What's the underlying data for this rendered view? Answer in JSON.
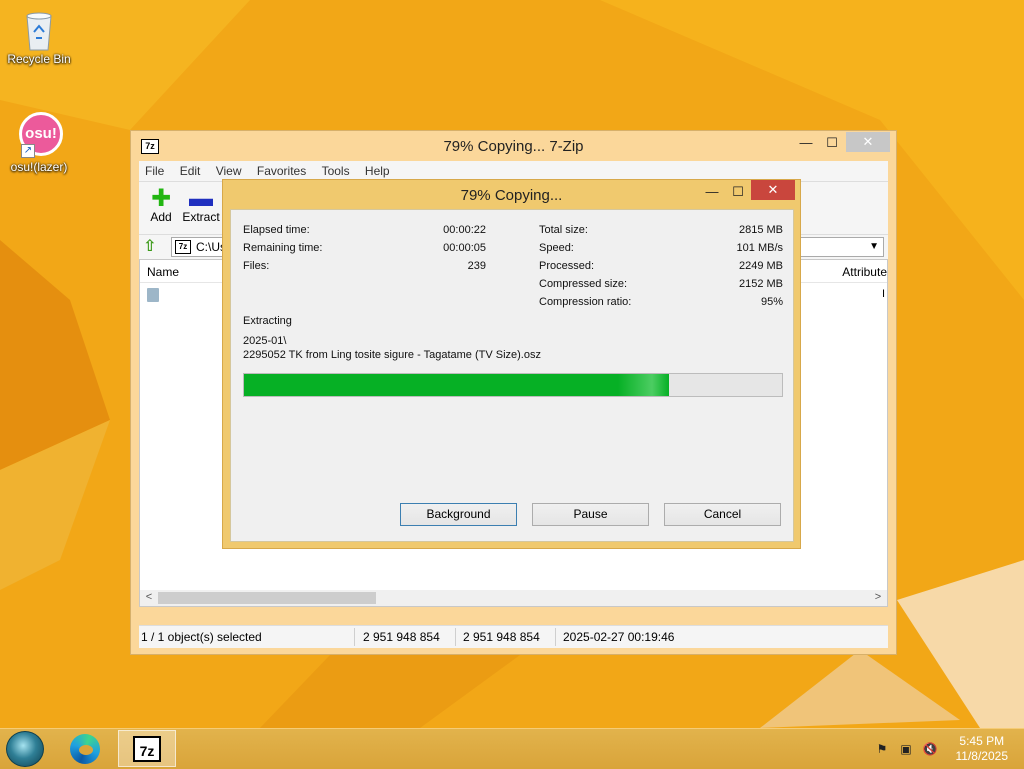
{
  "desktop": {
    "icons": [
      {
        "label": "Recycle Bin"
      },
      {
        "label": "osu!(lazer)",
        "logo_text": "osu!"
      }
    ]
  },
  "main_window": {
    "title": "79% Copying... 7-Zip",
    "app_icon_text": "7z",
    "menu": [
      "File",
      "Edit",
      "View",
      "Favorites",
      "Tools",
      "Help"
    ],
    "toolbar": {
      "add_label": "Add",
      "extract_label": "Extract"
    },
    "address": "C:\\Us",
    "columns": {
      "name": "Name",
      "attributes": "Attribute"
    },
    "status": {
      "selection": "1 / 1 object(s) selected",
      "size": "2 951 948 854",
      "packed": "2 951 948 854",
      "modified": "2025-02-27 00:19:46"
    }
  },
  "progress_dialog": {
    "title": "79% Copying...",
    "progress": 0.79,
    "left_stats": [
      {
        "label": "Elapsed time:",
        "value": "00:00:22"
      },
      {
        "label": "Remaining time:",
        "value": "00:00:05"
      },
      {
        "label": "Files:",
        "value": "239"
      }
    ],
    "right_stats": [
      {
        "label": "Total size:",
        "value": "2815 MB"
      },
      {
        "label": "Speed:",
        "value": "101 MB/s"
      },
      {
        "label": "Processed:",
        "value": "2249 MB"
      },
      {
        "label": "Compressed size:",
        "value": "2152 MB"
      },
      {
        "label": "Compression ratio:",
        "value": "95%"
      }
    ],
    "operation": "Extracting",
    "current_folder": "2025-01\\",
    "current_file": "2295052 TK from Ling tosite sigure - Tagatame (TV Size).osz",
    "buttons": {
      "background": "Background",
      "pause": "Pause",
      "cancel": "Cancel"
    }
  },
  "taskbar": {
    "items": [
      "edge-icon",
      "7zip-icon"
    ],
    "zip_logo_text": "7z",
    "clock": {
      "time": "5:45 PM",
      "date": "11/8/2025"
    }
  },
  "colors": {
    "desktop_bg": "#f2a717",
    "progress_fill": "#06b025",
    "dialog_frame": "#f0c96e",
    "close_button": "#c9463d"
  }
}
